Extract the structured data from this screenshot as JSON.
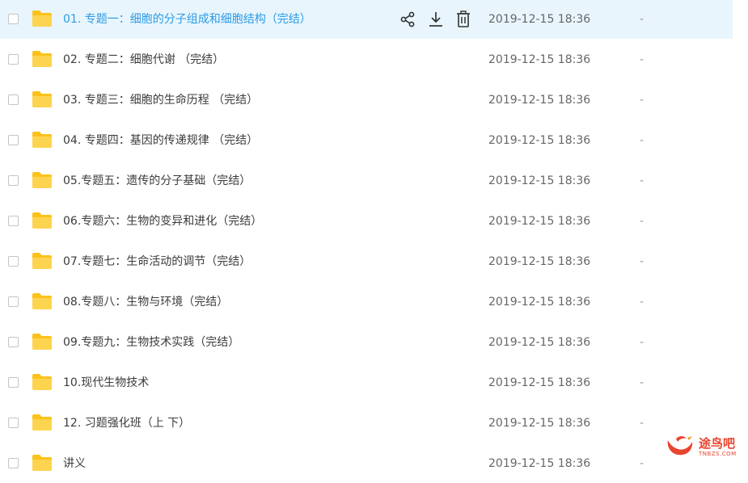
{
  "files": [
    {
      "name": "01. 专题一：细胞的分子组成和细胞结构（完结）",
      "date": "2019-12-15 18:36",
      "size": "-",
      "selected": true
    },
    {
      "name": "02. 专题二：细胞代谢 （完结）",
      "date": "2019-12-15 18:36",
      "size": "-"
    },
    {
      "name": "03. 专题三：细胞的生命历程 （完结）",
      "date": "2019-12-15 18:36",
      "size": "-"
    },
    {
      "name": "04. 专题四：基因的传递规律 （完结）",
      "date": "2019-12-15 18:36",
      "size": "-"
    },
    {
      "name": "05.专题五：遗传的分子基础（完结）",
      "date": "2019-12-15 18:36",
      "size": "-"
    },
    {
      "name": "06.专题六：生物的变异和进化（完结）",
      "date": "2019-12-15 18:36",
      "size": "-"
    },
    {
      "name": "07.专题七：生命活动的调节（完结）",
      "date": "2019-12-15 18:36",
      "size": "-"
    },
    {
      "name": "08.专题八：生物与环境（完结）",
      "date": "2019-12-15 18:36",
      "size": "-"
    },
    {
      "name": "09.专题九：生物技术实践（完结）",
      "date": "2019-12-15 18:36",
      "size": "-"
    },
    {
      "name": "10.现代生物技术",
      "date": "2019-12-15 18:36",
      "size": "-"
    },
    {
      "name": "12. 习题强化班（上 下）",
      "date": "2019-12-15 18:36",
      "size": "-"
    },
    {
      "name": "讲义",
      "date": "2019-12-15 18:36",
      "size": "-"
    }
  ],
  "row_actions": {
    "share_icon": "share-icon",
    "download_icon": "download-icon",
    "delete_icon": "trash-icon"
  },
  "colors": {
    "folder": "#fcc21b",
    "selected_bg": "#e8f5fd",
    "selected_text": "#2b9be4",
    "watermark": "#e8452f"
  },
  "watermark": {
    "text": "途鸟吧",
    "sub": "TNBZS.COM"
  }
}
